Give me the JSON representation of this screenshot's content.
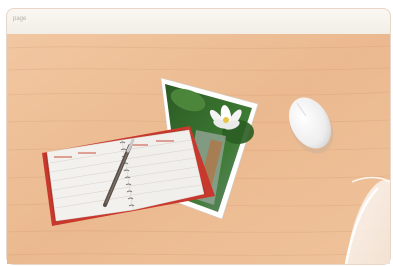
{
  "mat": {
    "strip_label": "page",
    "wood_color": "#eec09a",
    "strip_color": "#f4f0ea"
  },
  "objects": {
    "planner": {
      "cover_color": "#c8382c",
      "page_color": "#f3f1ee"
    },
    "pen": {
      "color": "#5a5048"
    },
    "photo": {
      "subject": "water-lily",
      "leaf_color": "#2f6b2a"
    },
    "mouse": {
      "color": "#f5f5f5"
    },
    "corner": {
      "style": "clear-film-curl"
    }
  }
}
